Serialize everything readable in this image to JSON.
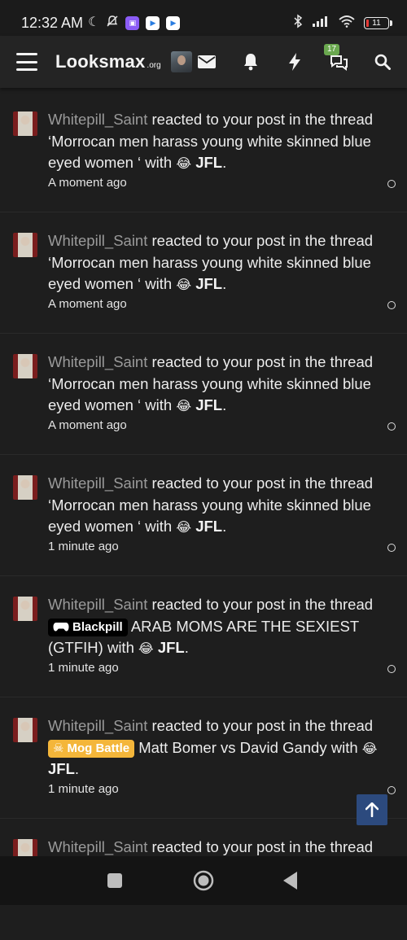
{
  "status_bar": {
    "time": "12:32 AM",
    "battery": "11",
    "battery_color": "#e53935"
  },
  "nav": {
    "logo_main": "Looksmax",
    "logo_tld": ".org",
    "conversations_badge": "17",
    "icons": [
      "menu-icon",
      "envelope-icon",
      "bell-icon",
      "bolt-icon",
      "chat-bubbles-icon",
      "search-icon"
    ]
  },
  "notifications": [
    {
      "user": "Whitepill_Saint",
      "action": " reacted to your post in the thread ",
      "prefix": "",
      "thread": "‘Morrocan men harass young white skinned blue eyed women ‘",
      "with": " with ",
      "emoji": "😂",
      "reaction": "JFL",
      "end": ".",
      "time": "A moment ago"
    },
    {
      "user": "Whitepill_Saint",
      "action": " reacted to your post in the thread ",
      "prefix": "",
      "thread": "‘Morrocan men harass young white skinned blue eyed women ‘",
      "with": " with ",
      "emoji": "😂",
      "reaction": "JFL",
      "end": ".",
      "time": "A moment ago"
    },
    {
      "user": "Whitepill_Saint",
      "action": " reacted to your post in the thread ",
      "prefix": "",
      "thread": "‘Morrocan men harass young white skinned blue eyed women ‘",
      "with": " with ",
      "emoji": "😂",
      "reaction": "JFL",
      "end": ".",
      "time": "A moment ago"
    },
    {
      "user": "Whitepill_Saint",
      "action": " reacted to your post in the thread ",
      "prefix": "",
      "thread": "‘Morrocan men harass young white skinned blue eyed women ‘",
      "with": " with ",
      "emoji": "😂",
      "reaction": "JFL",
      "end": ".",
      "time": "1 minute ago"
    },
    {
      "user": "Whitepill_Saint",
      "action": " reacted to your post in the thread ",
      "prefix": "Blackpill",
      "prefix_icon": "gamepad-icon",
      "thread": " ARAB MOMS ARE THE SEXIEST (GTFIH)",
      "with": " with ",
      "emoji": "😂",
      "reaction": "JFL",
      "end": ".",
      "time": "1 minute ago"
    },
    {
      "user": "Whitepill_Saint",
      "action": " reacted to your post in the thread ",
      "prefix": "Mog Battle",
      "prefix_icon": "skull-icon",
      "thread": " Matt Bomer vs David Gandy",
      "with": " with ",
      "emoji": "😂",
      "reaction": "JFL",
      "end": ".",
      "time": "1 minute ago"
    },
    {
      "user": "Whitepill_Saint",
      "action": " reacted to your post in the thread",
      "prefix": "",
      "thread": "",
      "with": "",
      "emoji": "",
      "reaction": "",
      "end": "",
      "time": ""
    }
  ],
  "colors": {
    "background": "#1e1e1e",
    "navbar": "#242424",
    "username": "#9a9a9a",
    "blackpill_prefix": "#000000",
    "mog_battle_prefix": "#f4b63a",
    "scroll_top_button": "#2c4a7e"
  }
}
